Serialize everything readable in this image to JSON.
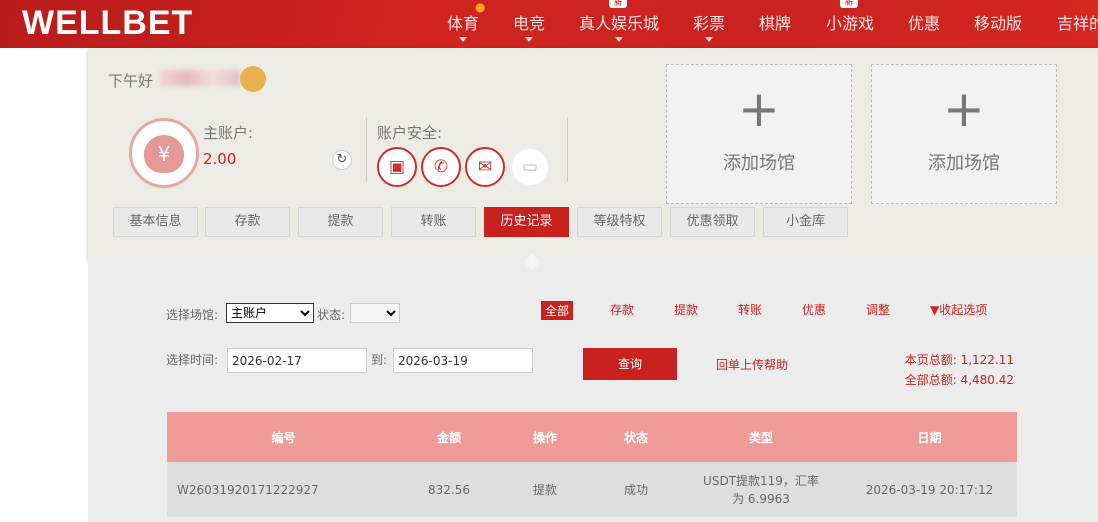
{
  "header": {
    "logo": "WELLBET",
    "nav": [
      {
        "label": "体育",
        "caret": true,
        "hot": true
      },
      {
        "label": "电竞",
        "caret": true
      },
      {
        "label": "真人娱乐城",
        "caret": true,
        "badge": "新"
      },
      {
        "label": "彩票",
        "caret": true
      },
      {
        "label": "棋牌"
      },
      {
        "label": "小游戏",
        "badge": "新"
      },
      {
        "label": "优惠"
      },
      {
        "label": "移动版"
      },
      {
        "label": "吉祥的"
      }
    ]
  },
  "account": {
    "greeting": "下午好",
    "main_label": "主账户:",
    "balance": "2.00",
    "security_label": "账户安全:",
    "security_icons": [
      "id-card-icon",
      "sms-phone-icon",
      "email-icon",
      "bank-card-icon"
    ],
    "add_venue": "添加场馆",
    "add_plus": "+"
  },
  "tabs": [
    "基本信息",
    "存款",
    "提款",
    "转账",
    "历史记录",
    "等级特权",
    "优惠领取",
    "小金库"
  ],
  "active_tab": "历史记录",
  "filters": {
    "venue_label": "选择场馆:",
    "venue_value": "主账户",
    "status_label": "状态:",
    "time_label": "选择时间:",
    "from": "2026-02-17",
    "to_label": "到:",
    "to": "2026-03-19",
    "query": "查询",
    "help": "回单上传帮助",
    "types": [
      "全部",
      "存款",
      "提款",
      "转账",
      "优惠",
      "调整"
    ],
    "collapse": "▼收起选项",
    "page_total": "本页总额: 1,122.11",
    "all_total": "全部总额: 4,480.42"
  },
  "table": {
    "headers": [
      "编号",
      "金额",
      "操作",
      "状态",
      "类型",
      "日期"
    ],
    "rows": [
      [
        "W26031920171222927",
        "832.56",
        "提款",
        "成功",
        "USDT提款119，汇率为 6.9963",
        "2026-03-19 20:17:12"
      ]
    ]
  },
  "colors": {
    "brand": "#d0231f",
    "table_header": "#ef9c98"
  }
}
